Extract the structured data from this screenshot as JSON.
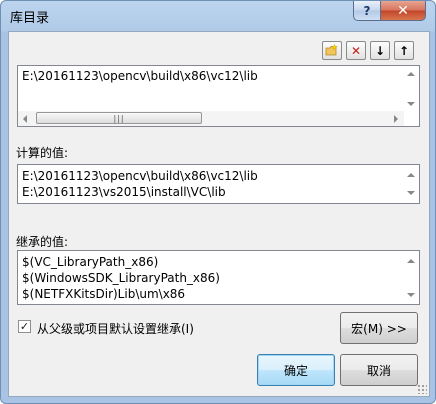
{
  "window": {
    "title": "库目录",
    "help_label": "?",
    "close_label": "✕"
  },
  "toolbar": {
    "new_icon": "new-folder-icon",
    "delete_icon": "delete-icon",
    "move_down_icon": "move-down-icon",
    "move_up_icon": "move-up-icon",
    "delete_glyph": "✕",
    "down_glyph": "↓",
    "up_glyph": "↑"
  },
  "edit_list": {
    "lines": [
      "E:\\20161123\\opencv\\build\\x86\\vc12\\lib"
    ]
  },
  "computed": {
    "label": "计算的值:",
    "lines": [
      "E:\\20161123\\opencv\\build\\x86\\vc12\\lib",
      "E:\\20161123\\vs2015\\install\\VC\\lib"
    ]
  },
  "inherited": {
    "label": "继承的值:",
    "lines": [
      "$(VC_LibraryPath_x86)",
      "$(WindowsSDK_LibraryPath_x86)",
      "$(NETFXKitsDir)Lib\\um\\x86"
    ]
  },
  "inherit_checkbox": {
    "checked": true,
    "check_glyph": "✓",
    "label": "从父级或项目默认设置继承(I)"
  },
  "buttons": {
    "macro": "宏(M) >>",
    "ok": "确定",
    "cancel": "取消"
  },
  "colors": {
    "title_bar": "#b0cae8",
    "close_button": "#c1452a",
    "default_button_border": "#3c7fb1"
  }
}
